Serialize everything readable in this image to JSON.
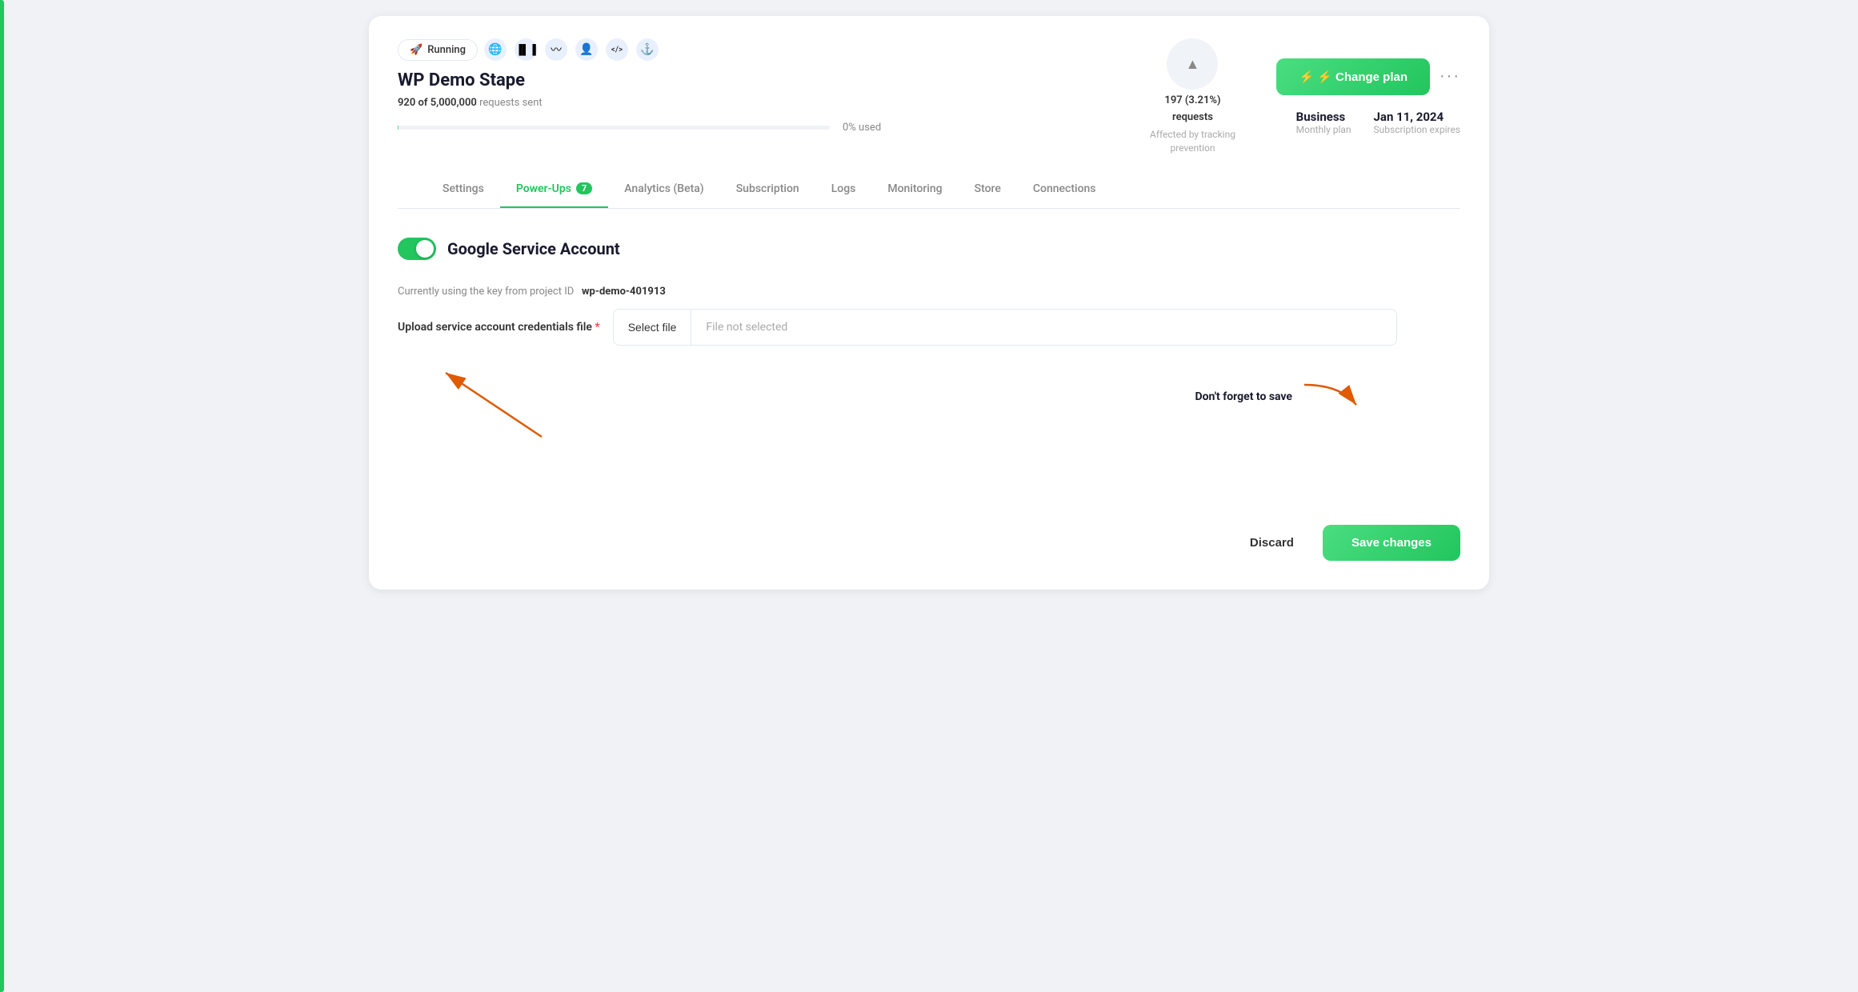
{
  "app": {
    "title": "WP Demo Stape"
  },
  "header": {
    "status_badge": "Running",
    "site_name": "WP Demo Stape",
    "requests_sent": "920 of 5,000,000",
    "requests_label": "requests sent",
    "percent_used": "0% used",
    "tracking_stats": "197 (3.21%)",
    "tracking_sublabel": "requests",
    "tracking_label": "Affected by tracking prevention",
    "change_plan_label": "⚡ Change plan",
    "plan_name": "Business",
    "plan_sub": "Monthly plan",
    "plan_date": "Jan 11, 2024",
    "plan_date_sub": "Subscription expires",
    "more_icon": "···",
    "info_icon": "i"
  },
  "tabs": [
    {
      "label": "Settings",
      "active": false,
      "badge": null
    },
    {
      "label": "Power-Ups",
      "active": true,
      "badge": "7"
    },
    {
      "label": "Analytics (Beta)",
      "active": false,
      "badge": null
    },
    {
      "label": "Subscription",
      "active": false,
      "badge": null
    },
    {
      "label": "Logs",
      "active": false,
      "badge": null
    },
    {
      "label": "Monitoring",
      "active": false,
      "badge": null
    },
    {
      "label": "Store",
      "active": false,
      "badge": null
    },
    {
      "label": "Connections",
      "active": false,
      "badge": null
    }
  ],
  "content": {
    "section_title": "Google Service Account",
    "toggle_state": "on",
    "project_id_label": "Currently using the key from project ID",
    "project_id_value": "wp-demo-401913",
    "upload_label": "Upload service account credentials file",
    "required_star": "*",
    "select_file_btn": "Select file",
    "file_placeholder": "File not selected",
    "dont_forget_text": "Don't forget to save",
    "discard_btn": "Discard",
    "save_btn": "Save changes"
  },
  "icons": {
    "rocket": "🚀",
    "globe1": "🌐",
    "bars": "📊",
    "wave": "〰",
    "person": "👤",
    "code": "</>",
    "anchor": "⚓",
    "chevron_up": "▲",
    "lightning": "⚡"
  }
}
